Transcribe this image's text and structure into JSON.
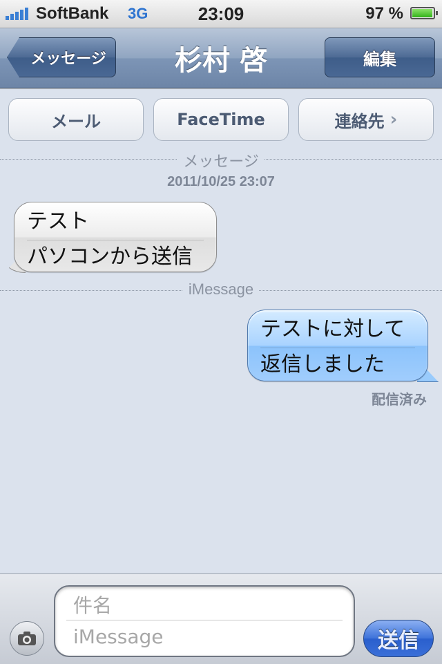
{
  "status_bar": {
    "carrier": "SoftBank",
    "network": "3G",
    "time": "23:09",
    "battery": "97 %",
    "battery_level": 0.97
  },
  "nav": {
    "back_label": "メッセージ",
    "title": "杉村 啓",
    "edit_label": "編集"
  },
  "actions": {
    "mail_label": "メール",
    "facetime_label": "FaceTime",
    "contact_label": "連絡先"
  },
  "conversation": {
    "sep1_label": "メッセージ",
    "timestamp": "2011/10/25 23:07",
    "incoming": {
      "subject": "テスト",
      "body": "パソコンから送信"
    },
    "sep2_label": "iMessage",
    "outgoing": {
      "subject": "テストに対して",
      "body": "返信しました"
    },
    "delivered": "配信済み"
  },
  "compose": {
    "subject_placeholder": "件名",
    "body_placeholder": "iMessage",
    "send_label": "送信"
  },
  "colors": {
    "background": "#dbe2ed",
    "incoming_bubble": "#e8e8e8",
    "outgoing_bubble": "#a9d3ff",
    "send_button": "#3d72da"
  }
}
